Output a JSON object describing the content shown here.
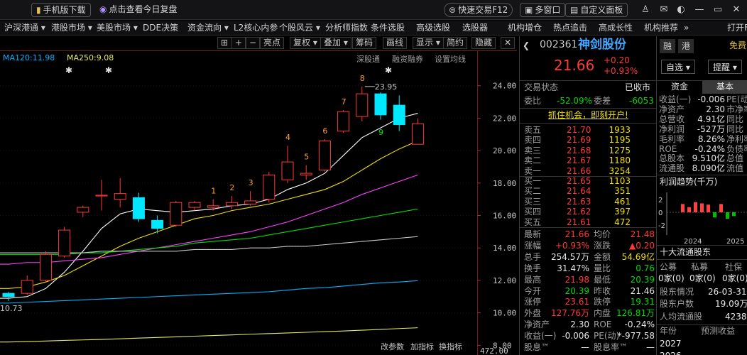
{
  "topbar": {
    "mobile_download": "手机版下载",
    "daily_review": "点击查看今日复盘",
    "quick_trade": "快速交易F12",
    "multi_window": "多窗口",
    "custom_panel": "自定义面板"
  },
  "menu": {
    "items": [
      "沪深港通 ▾",
      "港股市场 ▾",
      "美股市场 ▾",
      "DDE决策",
      "资金流向 ▾",
      "L2核心内参",
      "个股风云 ▾",
      "分析师指数",
      "条件选股",
      "高级选股",
      "选股器",
      "机构增仓",
      "热点追击",
      "高成长性",
      "机构推荐",
      "»",
      "打开F"
    ]
  },
  "chart_toolbar": {
    "items": [
      "亮点",
      "复权 ▾",
      "叠加 ▾",
      "筹码",
      "画线",
      "显示 ▾",
      "简约",
      "隐藏"
    ],
    "sub_items": [
      "深股通",
      "融资融券",
      "设置均线"
    ],
    "bottom_items": [
      "改参数",
      "加指标",
      "换指标"
    ],
    "ma120": "MA120:11.98",
    "ma250": "MA250:9.08",
    "high_label": "23.95",
    "low_label": "10.73",
    "bottom_price": "472.00",
    "y_ticks": [
      "24.00",
      "22.00",
      "20.00",
      "18.00",
      "16.00",
      "14.00",
      "12.00",
      "10.00",
      "8.00"
    ],
    "count_labels": [
      "1",
      "2",
      "3",
      "4",
      "5",
      "6",
      "7",
      "8",
      "9"
    ]
  },
  "chart_data": {
    "type": "candlestick",
    "ylim": [
      7.4,
      25.3
    ],
    "candles": [
      {
        "o": 11.2,
        "c": 11.0,
        "h": 11.3,
        "l": 10.73
      },
      {
        "o": 11.2,
        "c": 12.0,
        "h": 12.3,
        "l": 11.1
      },
      {
        "o": 12.0,
        "c": 13.6,
        "h": 13.8,
        "l": 11.9
      },
      {
        "o": 13.5,
        "c": 15.1,
        "h": 15.3,
        "l": 13.4
      },
      {
        "o": 16.2,
        "c": 16.5,
        "h": 16.6,
        "l": 15.9
      },
      {
        "o": 17.2,
        "c": 17.25,
        "h": 18.2,
        "l": 16.3
      },
      {
        "o": 17.0,
        "c": 17.35,
        "h": 18.3,
        "l": 16.5
      },
      {
        "o": 17.1,
        "c": 15.8,
        "h": 17.4,
        "l": 15.6
      },
      {
        "o": 15.7,
        "c": 15.2,
        "h": 16.0,
        "l": 14.9
      },
      {
        "o": 15.4,
        "c": 16.8,
        "h": 16.9,
        "l": 15.3
      },
      {
        "o": 16.5,
        "c": 16.8,
        "h": 16.9,
        "l": 16.3
      },
      {
        "o": 16.5,
        "c": 16.6,
        "h": 17.0,
        "l": 16.3
      },
      {
        "o": 16.6,
        "c": 16.8,
        "h": 17.2,
        "l": 16.4
      },
      {
        "o": 16.7,
        "c": 16.9,
        "h": 17.5,
        "l": 16.6
      },
      {
        "o": 17.0,
        "c": 18.5,
        "h": 18.7,
        "l": 16.8
      },
      {
        "o": 18.2,
        "c": 19.3,
        "h": 20.3,
        "l": 18.0
      },
      {
        "o": 18.5,
        "c": 18.6,
        "h": 19.1,
        "l": 18.2
      },
      {
        "o": 18.8,
        "c": 20.6,
        "h": 20.7,
        "l": 18.7
      },
      {
        "o": 21.2,
        "c": 22.4,
        "h": 22.5,
        "l": 21.1
      },
      {
        "o": 22.1,
        "c": 23.5,
        "h": 23.95,
        "l": 21.8
      },
      {
        "o": 23.5,
        "c": 22.2,
        "h": 23.6,
        "l": 21.9
      },
      {
        "o": 22.8,
        "c": 21.6,
        "h": 23.4,
        "l": 21.2
      },
      {
        "o": 20.39,
        "c": 21.66,
        "h": 21.98,
        "l": 20.39
      }
    ],
    "ma_lines": [
      {
        "name": "MA5",
        "color": "#ffffff",
        "values": [
          10.9,
          11.0,
          11.5,
          12.5,
          13.8,
          15.2,
          16.1,
          16.4,
          16.3,
          16.2,
          16.3,
          16.4,
          16.6,
          16.7,
          17.0,
          17.6,
          18.0,
          18.6,
          19.7,
          20.8,
          21.4,
          22.0,
          22.3
        ]
      },
      {
        "name": "MA10",
        "color": "#f0e000",
        "values": [
          11.5,
          11.6,
          11.9,
          12.3,
          12.9,
          13.5,
          14.1,
          14.6,
          15.0,
          15.4,
          15.8,
          16.0,
          16.3,
          16.5,
          16.7,
          17.0,
          17.3,
          17.6,
          18.1,
          18.8,
          19.5,
          20.1,
          20.6
        ]
      },
      {
        "name": "MA20",
        "color": "#ff40ff",
        "values": [
          13.0,
          13.1,
          13.1,
          13.2,
          13.3,
          13.4,
          13.6,
          13.8,
          14.0,
          14.2,
          14.4,
          14.6,
          14.8,
          15.0,
          15.3,
          15.6,
          16.0,
          16.4,
          16.8,
          17.3,
          17.7,
          18.1,
          18.5
        ]
      },
      {
        "name": "MA30",
        "color": "#00e000",
        "values": [
          13.6,
          13.6,
          13.6,
          13.6,
          13.7,
          13.7,
          13.8,
          13.9,
          14.0,
          14.1,
          14.3,
          14.4,
          14.5,
          14.6,
          14.8,
          15.0,
          15.2,
          15.4,
          15.6,
          15.8,
          16.0,
          16.2,
          16.4
        ]
      },
      {
        "name": "MA60",
        "color": "#c8c8c8",
        "values": [
          13.7,
          13.7,
          13.7,
          13.7,
          13.7,
          13.8,
          13.8,
          13.8,
          13.8,
          13.8,
          13.9,
          13.9,
          13.9,
          14.0,
          14.0,
          14.1,
          14.1,
          14.2,
          14.3,
          14.4,
          14.5,
          14.6,
          14.7
        ]
      },
      {
        "name": "MA120",
        "color": "#00b0ff",
        "values": [
          10.6,
          10.65,
          10.7,
          10.75,
          10.8,
          10.85,
          10.9,
          10.95,
          11.0,
          11.05,
          11.1,
          11.15,
          11.2,
          11.25,
          11.3,
          11.4,
          11.5,
          11.55,
          11.65,
          11.75,
          11.85,
          11.9,
          11.98
        ]
      },
      {
        "name": "MA250",
        "color": "#e8e860",
        "values": [
          8.2,
          8.23,
          8.26,
          8.3,
          8.33,
          8.36,
          8.4,
          8.44,
          8.48,
          8.52,
          8.56,
          8.6,
          8.64,
          8.68,
          8.72,
          8.76,
          8.8,
          8.84,
          8.88,
          8.93,
          8.98,
          9.03,
          9.08
        ]
      }
    ]
  },
  "quote": {
    "code": "002361",
    "name": "神剑股份",
    "price": "21.66",
    "change": "+0.20",
    "change_pct": "+0.93%",
    "status_label": "交易状态",
    "status_value": "已收市",
    "wei_bi_label": "委比",
    "wei_bi": "-52.09%",
    "wei_cha_label": "委差",
    "wei_cha": "-6053",
    "promo": "抓住机会，即刻开户!",
    "sell": [
      {
        "label": "卖五",
        "price": "21.70",
        "vol": "1933"
      },
      {
        "label": "卖四",
        "price": "21.69",
        "vol": "1195"
      },
      {
        "label": "卖三",
        "price": "21.68",
        "vol": "1275"
      },
      {
        "label": "卖二",
        "price": "21.67",
        "vol": "1180"
      },
      {
        "label": "卖一",
        "price": "21.66",
        "vol": "3254"
      }
    ],
    "buy": [
      {
        "label": "买一",
        "price": "21.65",
        "vol": "1103"
      },
      {
        "label": "买二",
        "price": "21.64",
        "vol": "351"
      },
      {
        "label": "买三",
        "price": "21.63",
        "vol": "461"
      },
      {
        "label": "买四",
        "price": "21.62",
        "vol": "397"
      },
      {
        "label": "买五",
        "price": "21.61",
        "vol": "472"
      }
    ],
    "stats": [
      {
        "l1": "最新",
        "v1": "21.66",
        "c1": "red",
        "l2": "均价",
        "v2": "21.48",
        "c2": "red"
      },
      {
        "l1": "涨幅",
        "v1": "+0.93%",
        "c1": "red",
        "l2": "涨跌",
        "v2": "▲0.20",
        "c2": "red"
      },
      {
        "l1": "总手",
        "v1": "254.57万",
        "c1": "white",
        "l2": "金额",
        "v2": "54.69亿",
        "c2": "yellow"
      },
      {
        "l1": "换手",
        "v1": "31.47%",
        "c1": "white",
        "l2": "量比",
        "v2": "0.76",
        "c2": "green"
      },
      {
        "l1": "最高",
        "v1": "21.98",
        "c1": "red",
        "l2": "最低",
        "v2": "20.39",
        "c2": "green"
      },
      {
        "l1": "今开",
        "v1": "20.39",
        "c1": "green",
        "l2": "昨收",
        "v2": "21.46",
        "c2": "white"
      },
      {
        "l1": "涨停",
        "v1": "23.61",
        "c1": "red",
        "l2": "跌停",
        "v2": "19.31",
        "c2": "green"
      },
      {
        "l1": "外盘",
        "v1": "127.76万",
        "c1": "red",
        "l2": "内盘",
        "v2": "126.81万",
        "c2": "green"
      },
      {
        "l1": "净资产",
        "v1": "2.30",
        "c1": "white",
        "l2": "ROE",
        "v2": "-0.24%",
        "c2": "white"
      },
      {
        "l1": "收益(一)",
        "v1": "-0.006",
        "c1": "white",
        "l2": "PE(动)",
        "v2": "*-977.58",
        "c2": "white"
      },
      {
        "l1": "股息™",
        "v1": "—",
        "c1": "white",
        "l2": "股息率™",
        "v2": "—",
        "c2": "white"
      }
    ],
    "tags": [
      "融",
      "港"
    ],
    "self_select": "自选 ▾",
    "remind": "提醒 ▾",
    "free": "免费"
  },
  "side": {
    "tab_fund": "资金",
    "tab_basic": "基本",
    "fundamentals": [
      {
        "label": "收益(一)",
        "value": "-0.006",
        "extra": "PE(动"
      },
      {
        "label": "净资产",
        "value": "2.30",
        "extra": "市净率"
      },
      {
        "label": "总营收",
        "value": "4.91亿",
        "extra": "同比"
      },
      {
        "label": "净利润",
        "value": "-527万",
        "extra": "同比"
      },
      {
        "label": "毛利率",
        "value": "8.26%",
        "extra": "净利率"
      },
      {
        "label": "ROE",
        "value": "-0.24%",
        "extra": "负债率"
      },
      {
        "label": "总股本",
        "value": "9.510亿",
        "extra": "总值"
      },
      {
        "label": "流通股",
        "value": "8.090亿",
        "extra": "流值"
      }
    ],
    "profit_title": "利润趋势(千万)",
    "profit_years": [
      "2024",
      "2025"
    ],
    "profit_ticks": [
      "2",
      "0",
      "-2"
    ],
    "profit_bars": [
      1.3,
      0.8,
      1.6,
      1.4,
      1.2,
      -0.8,
      1.3,
      -1.0,
      -0.6
    ],
    "holders_title": "十大流通股东",
    "holders_head": [
      "公募",
      "私募",
      "社保"
    ],
    "holders_values": [
      "0家(0)",
      "0家(0)",
      "0家(0)"
    ],
    "shareholders_label": "股东情况",
    "shareholders_date": "26-03-31",
    "holder_count_label": "股东户数",
    "holder_count": "19.09万",
    "per_capita_label": "人均流通股",
    "per_capita": "4238",
    "year_label": "年份",
    "forecast_label": "预测收益",
    "years": [
      "2027",
      "2026"
    ]
  }
}
